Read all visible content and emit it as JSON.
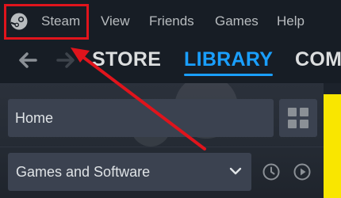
{
  "menubar": {
    "items": [
      {
        "label": "Steam"
      },
      {
        "label": "View"
      },
      {
        "label": "Friends"
      },
      {
        "label": "Games"
      },
      {
        "label": "Help"
      }
    ]
  },
  "nav": {
    "tabs": [
      {
        "label": "STORE"
      },
      {
        "label": "LIBRARY",
        "active": true
      },
      {
        "label": "COM"
      }
    ]
  },
  "library": {
    "home_label": "Home",
    "filter_value": "Games and Software"
  },
  "colors": {
    "accent": "#1a9fff",
    "annotation": "#e0141c",
    "menubar_bg": "#171d25",
    "field_bg": "#3b4250"
  },
  "icons": [
    "steam-logo-icon",
    "back-arrow-icon",
    "forward-arrow-icon",
    "grid-view-icon",
    "chevron-down-icon",
    "recent-clock-icon",
    "play-icon"
  ]
}
